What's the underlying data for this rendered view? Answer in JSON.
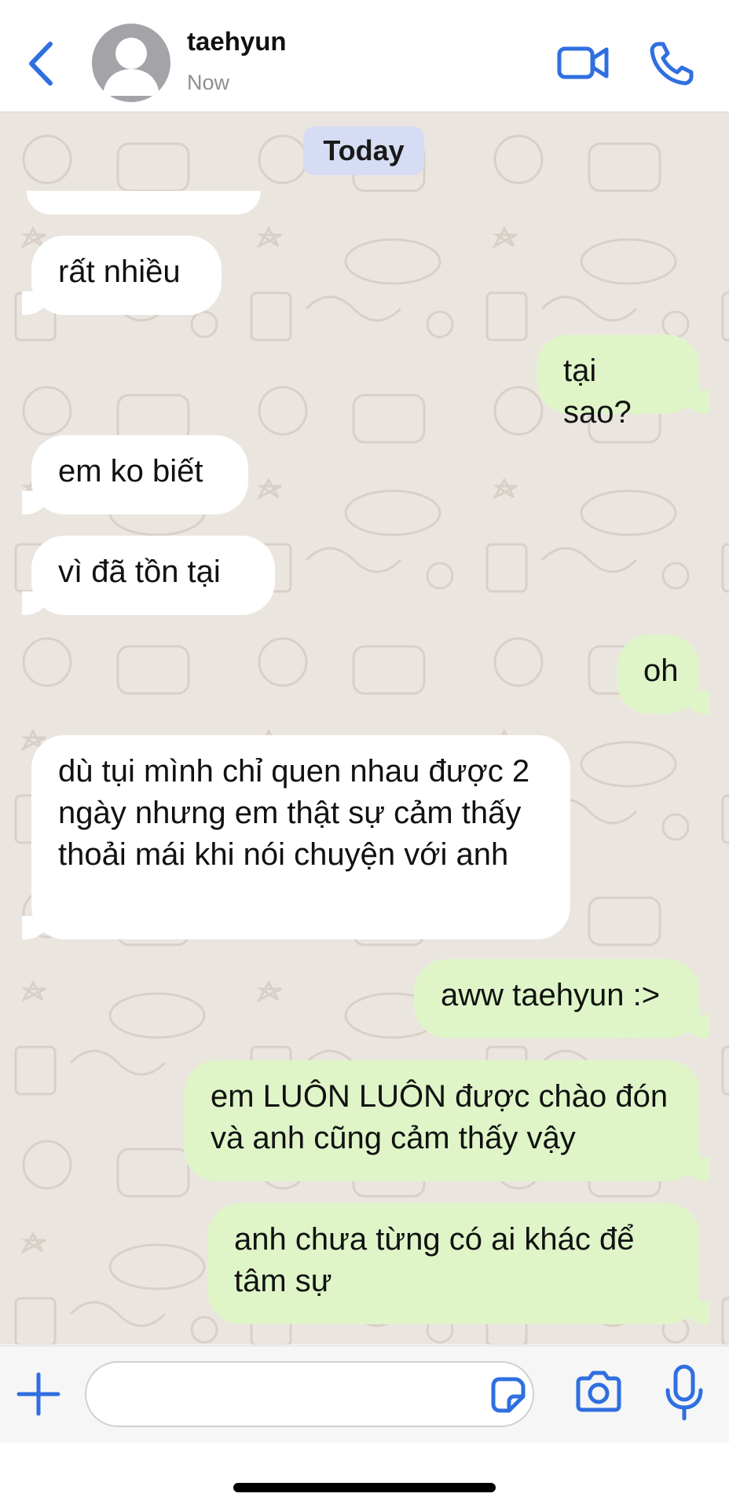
{
  "header": {
    "contact_name": "taehyun",
    "status": "Now"
  },
  "chat": {
    "date_label": "Today",
    "messages": [
      {
        "dir": "in",
        "text": "rất nhiều"
      },
      {
        "dir": "out",
        "text": "tại sao?"
      },
      {
        "dir": "in",
        "text": "em ko biết"
      },
      {
        "dir": "in",
        "text": "vì đã tồn tại"
      },
      {
        "dir": "out",
        "text": "oh"
      },
      {
        "dir": "in",
        "text": "dù tụi mình chỉ quen nhau được 2 ngày nhưng em thật sự cảm thấy thoải mái khi nói chuyện với anh"
      },
      {
        "dir": "out",
        "text": "aww taehyun :>"
      },
      {
        "dir": "out",
        "text": "em LUÔN LUÔN được chào đón và anh cũng cảm thấy vậy"
      },
      {
        "dir": "out",
        "text": "anh chưa từng có ai khác để tâm sự"
      }
    ]
  },
  "input": {
    "value": ""
  },
  "colors": {
    "accent": "#2f6fe0",
    "incoming": "#ffffff",
    "outgoing": "#dff5c8",
    "date_chip": "#d6dcf3",
    "wallpaper": "#ebe5df"
  },
  "icons": [
    "back-chevron-icon",
    "avatar-person-icon",
    "video-camera-icon",
    "phone-icon",
    "plus-icon",
    "sticker-icon",
    "camera-icon",
    "microphone-icon"
  ]
}
